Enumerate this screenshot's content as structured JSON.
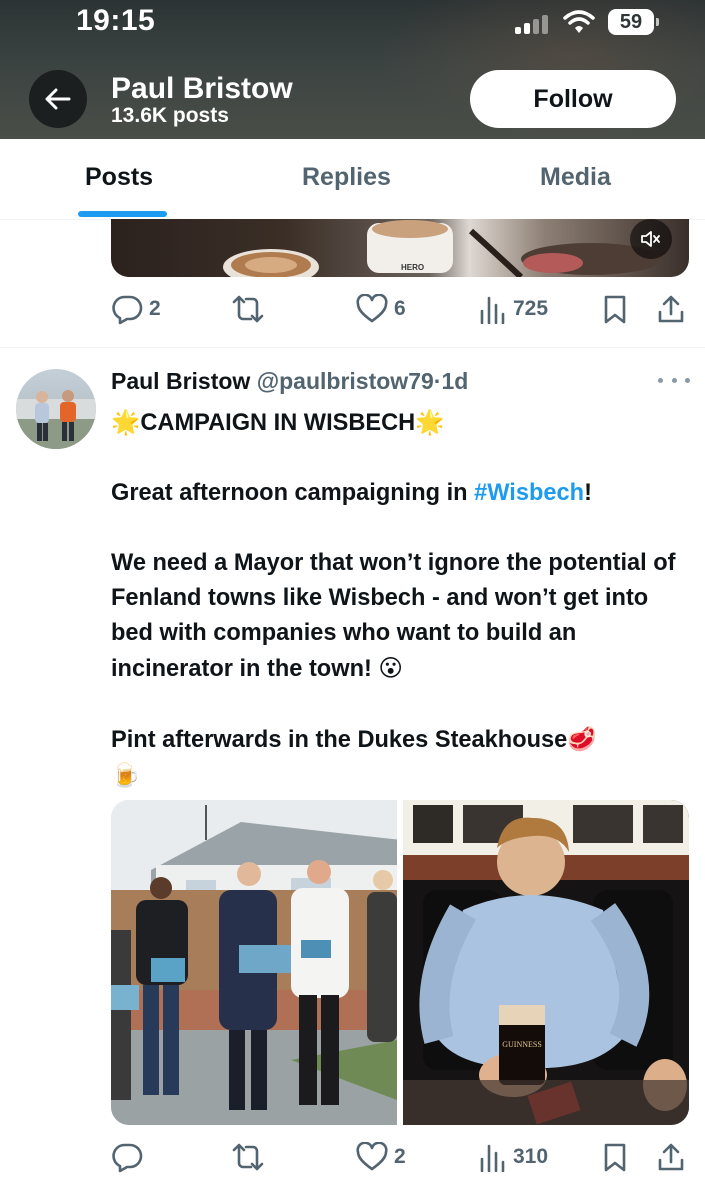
{
  "status_bar": {
    "time": "19:15",
    "battery": "59"
  },
  "header": {
    "name": "Paul Bristow",
    "posts_count": "13.6K posts",
    "follow_label": "Follow"
  },
  "tabs": [
    {
      "label": "Posts",
      "active": true
    },
    {
      "label": "Replies",
      "active": false
    },
    {
      "label": "Media",
      "active": false
    }
  ],
  "previous_tweet": {
    "media_brand": "HERO",
    "actions": {
      "replies": "2",
      "reposts": "",
      "likes": "6",
      "views": "725"
    }
  },
  "tweet": {
    "author_name": "Paul Bristow",
    "handle": "@paulbristow79",
    "separator": "·",
    "age": "1d",
    "lines": {
      "title_prefix": "🌟",
      "title": "CAMPAIGN IN WISBECH",
      "title_suffix": "🌟",
      "para1_start": "Great afternoon campaigning in ",
      "para1_hashtag": "#Wisbech",
      "para1_end": "!",
      "para2": "We need a Mayor that won’t ignore the potential of Fenland towns like Wisbech - and won’t get into bed with companies who want to build an incinerator in the town!",
      "para2_emoji": "😮",
      "para3": "Pint afterwards in the Dukes Steakhouse",
      "para3_emoji1": "🥩",
      "para3_emoji2": "🍺"
    },
    "media": {
      "photo2_glass_text": "GUINNESS"
    },
    "actions": {
      "replies": "",
      "reposts": "",
      "likes": "2",
      "views": "310"
    }
  },
  "colors": {
    "accent": "#1d9bf0",
    "secondary_text": "#536471",
    "header_bg": "#3b4342"
  },
  "icons": [
    "back-arrow-icon",
    "mute-icon",
    "reply-icon",
    "repost-icon",
    "like-icon",
    "views-icon",
    "bookmark-icon",
    "share-icon",
    "more-icon"
  ]
}
